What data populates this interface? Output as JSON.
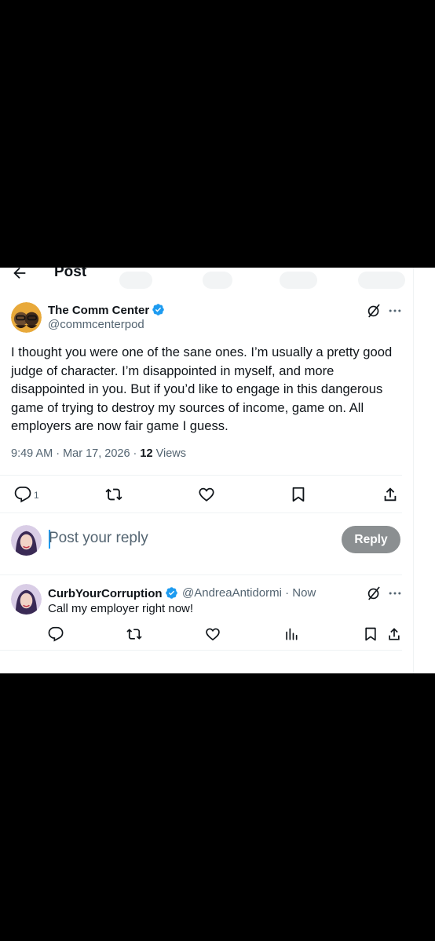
{
  "header": {
    "title": "Post"
  },
  "post": {
    "author_name": "The Comm Center",
    "author_handle": "@commcenterpod",
    "text": "I thought you were one of the sane ones. I’m usually a pretty good judge of character. I’m disappointed in myself, and more disappointed in you. But if you’d like to engage in this dangerous game of trying to destroy my sources of income, game on. All employers are now fair game I guess.",
    "timestamp": "9:49 AM · Mar 17, 2026 · ",
    "views_count": "12",
    "views_label": " Views",
    "reply_count": "1"
  },
  "composer": {
    "placeholder": "Post your reply",
    "reply_label": "Reply"
  },
  "reply": {
    "author_name": "CurbYourCorruption",
    "author_handle": "@AndreaAntidormi · Now",
    "text": "Call my employer right now!"
  },
  "colors": {
    "accent": "#1d9bf0",
    "verified": "#1d9bf0",
    "secondary_text": "#536471",
    "reply_button": "#8b8f91"
  },
  "icons": [
    "back-arrow-icon",
    "verified-icon",
    "grok-icon",
    "more-icon",
    "reply-icon",
    "retweet-icon",
    "like-icon",
    "bookmark-icon",
    "share-icon",
    "views-icon"
  ]
}
